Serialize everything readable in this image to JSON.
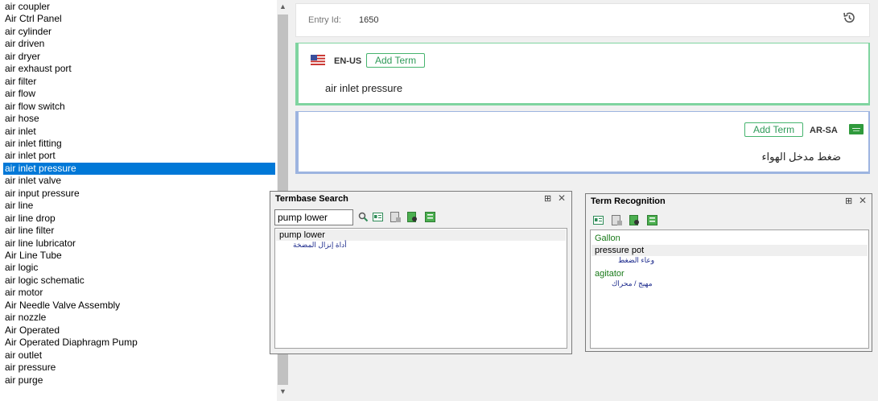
{
  "term_list": {
    "items": [
      "air coupler",
      "Air Ctrl Panel",
      "air cylinder",
      "air driven",
      "air dryer",
      "air exhaust port",
      "air filter",
      "air flow",
      "air flow switch",
      "air hose",
      "air inlet",
      "air inlet fitting",
      "air inlet port",
      "air inlet pressure",
      "air inlet valve",
      "air input pressure",
      "air line",
      "air line drop",
      "air line filter",
      "air line lubricator",
      "Air Line Tube",
      "air logic",
      "air logic schematic",
      "air motor",
      "Air Needle Valve Assembly",
      "air nozzle",
      "Air Operated",
      "Air Operated Diaphragm Pump",
      "air outlet",
      "air pressure",
      "air purge"
    ],
    "selected": "air inlet pressure"
  },
  "entry": {
    "id_label": "Entry Id:",
    "id_value": "1650",
    "languages": [
      {
        "code": "EN-US",
        "add_label": "Add Term",
        "term": "air inlet pressure",
        "accent": "#7fd4a0"
      },
      {
        "code": "AR-SA",
        "add_label": "Add Term",
        "term": "ضغط مدخل الهواء",
        "accent": "#9db4e0"
      }
    ]
  },
  "termbase_search": {
    "title": "Termbase Search",
    "query": "pump lower",
    "results": [
      {
        "term": "pump lower",
        "translation": "أداة إنزال المضخة"
      }
    ]
  },
  "term_recognition": {
    "title": "Term Recognition",
    "results": [
      {
        "term": "Gallon",
        "translation": "",
        "color": "#1a7a1a"
      },
      {
        "term": "pressure pot",
        "translation": "وعاء الضغط",
        "color": "#000000"
      },
      {
        "term": "agitator",
        "translation": "مهيج / محراك",
        "color": "#1a7a1a"
      }
    ]
  }
}
